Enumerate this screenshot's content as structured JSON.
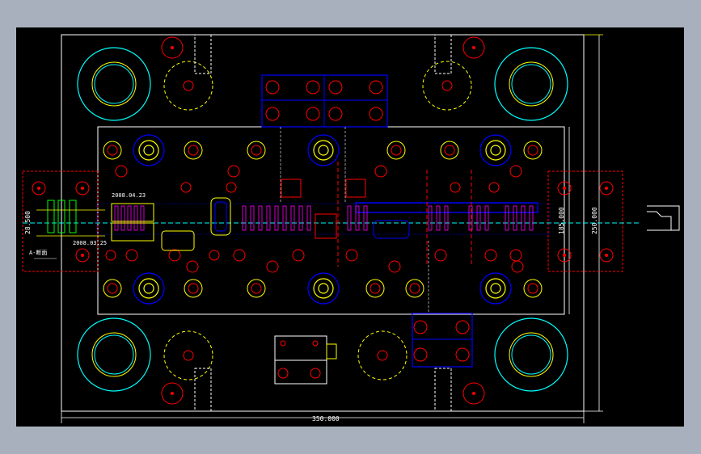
{
  "drawing": {
    "dimensions": {
      "bottom_width": "350.000",
      "right_height_inner": "185.000",
      "right_height_outer": "250.000",
      "left_small": "28.500"
    },
    "notes": {
      "date_top": "2008.04.23",
      "date_bottom": "2008.03.25",
      "left_label": "A-断面"
    }
  },
  "colors": {
    "background": "#000000",
    "frame": "#a9b0bd",
    "outline": "#ffffff",
    "red": "#ff0000",
    "blue": "#0000ff",
    "cyan": "#00ffff",
    "yellow": "#ffff00",
    "green": "#00ff00",
    "magenta": "#ff00ff"
  }
}
